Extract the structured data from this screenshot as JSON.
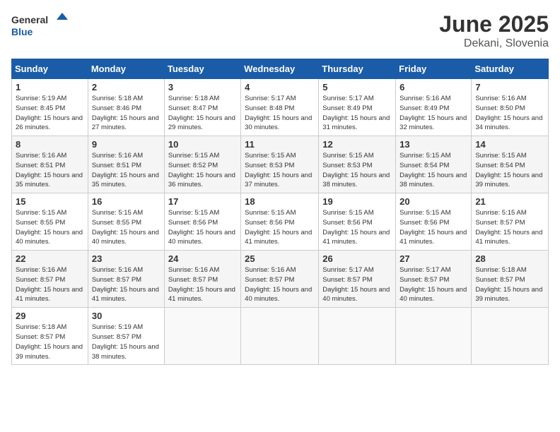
{
  "header": {
    "logo_line1": "General",
    "logo_line2": "Blue",
    "month_year": "June 2025",
    "location": "Dekani, Slovenia"
  },
  "columns": [
    "Sunday",
    "Monday",
    "Tuesday",
    "Wednesday",
    "Thursday",
    "Friday",
    "Saturday"
  ],
  "weeks": [
    [
      {
        "day": "1",
        "sunrise": "Sunrise: 5:19 AM",
        "sunset": "Sunset: 8:45 PM",
        "daylight": "Daylight: 15 hours and 26 minutes."
      },
      {
        "day": "2",
        "sunrise": "Sunrise: 5:18 AM",
        "sunset": "Sunset: 8:46 PM",
        "daylight": "Daylight: 15 hours and 27 minutes."
      },
      {
        "day": "3",
        "sunrise": "Sunrise: 5:18 AM",
        "sunset": "Sunset: 8:47 PM",
        "daylight": "Daylight: 15 hours and 29 minutes."
      },
      {
        "day": "4",
        "sunrise": "Sunrise: 5:17 AM",
        "sunset": "Sunset: 8:48 PM",
        "daylight": "Daylight: 15 hours and 30 minutes."
      },
      {
        "day": "5",
        "sunrise": "Sunrise: 5:17 AM",
        "sunset": "Sunset: 8:49 PM",
        "daylight": "Daylight: 15 hours and 31 minutes."
      },
      {
        "day": "6",
        "sunrise": "Sunrise: 5:16 AM",
        "sunset": "Sunset: 8:49 PM",
        "daylight": "Daylight: 15 hours and 32 minutes."
      },
      {
        "day": "7",
        "sunrise": "Sunrise: 5:16 AM",
        "sunset": "Sunset: 8:50 PM",
        "daylight": "Daylight: 15 hours and 34 minutes."
      }
    ],
    [
      {
        "day": "8",
        "sunrise": "Sunrise: 5:16 AM",
        "sunset": "Sunset: 8:51 PM",
        "daylight": "Daylight: 15 hours and 35 minutes."
      },
      {
        "day": "9",
        "sunrise": "Sunrise: 5:16 AM",
        "sunset": "Sunset: 8:51 PM",
        "daylight": "Daylight: 15 hours and 35 minutes."
      },
      {
        "day": "10",
        "sunrise": "Sunrise: 5:15 AM",
        "sunset": "Sunset: 8:52 PM",
        "daylight": "Daylight: 15 hours and 36 minutes."
      },
      {
        "day": "11",
        "sunrise": "Sunrise: 5:15 AM",
        "sunset": "Sunset: 8:53 PM",
        "daylight": "Daylight: 15 hours and 37 minutes."
      },
      {
        "day": "12",
        "sunrise": "Sunrise: 5:15 AM",
        "sunset": "Sunset: 8:53 PM",
        "daylight": "Daylight: 15 hours and 38 minutes."
      },
      {
        "day": "13",
        "sunrise": "Sunrise: 5:15 AM",
        "sunset": "Sunset: 8:54 PM",
        "daylight": "Daylight: 15 hours and 38 minutes."
      },
      {
        "day": "14",
        "sunrise": "Sunrise: 5:15 AM",
        "sunset": "Sunset: 8:54 PM",
        "daylight": "Daylight: 15 hours and 39 minutes."
      }
    ],
    [
      {
        "day": "15",
        "sunrise": "Sunrise: 5:15 AM",
        "sunset": "Sunset: 8:55 PM",
        "daylight": "Daylight: 15 hours and 40 minutes."
      },
      {
        "day": "16",
        "sunrise": "Sunrise: 5:15 AM",
        "sunset": "Sunset: 8:55 PM",
        "daylight": "Daylight: 15 hours and 40 minutes."
      },
      {
        "day": "17",
        "sunrise": "Sunrise: 5:15 AM",
        "sunset": "Sunset: 8:56 PM",
        "daylight": "Daylight: 15 hours and 40 minutes."
      },
      {
        "day": "18",
        "sunrise": "Sunrise: 5:15 AM",
        "sunset": "Sunset: 8:56 PM",
        "daylight": "Daylight: 15 hours and 41 minutes."
      },
      {
        "day": "19",
        "sunrise": "Sunrise: 5:15 AM",
        "sunset": "Sunset: 8:56 PM",
        "daylight": "Daylight: 15 hours and 41 minutes."
      },
      {
        "day": "20",
        "sunrise": "Sunrise: 5:15 AM",
        "sunset": "Sunset: 8:56 PM",
        "daylight": "Daylight: 15 hours and 41 minutes."
      },
      {
        "day": "21",
        "sunrise": "Sunrise: 5:15 AM",
        "sunset": "Sunset: 8:57 PM",
        "daylight": "Daylight: 15 hours and 41 minutes."
      }
    ],
    [
      {
        "day": "22",
        "sunrise": "Sunrise: 5:16 AM",
        "sunset": "Sunset: 8:57 PM",
        "daylight": "Daylight: 15 hours and 41 minutes."
      },
      {
        "day": "23",
        "sunrise": "Sunrise: 5:16 AM",
        "sunset": "Sunset: 8:57 PM",
        "daylight": "Daylight: 15 hours and 41 minutes."
      },
      {
        "day": "24",
        "sunrise": "Sunrise: 5:16 AM",
        "sunset": "Sunset: 8:57 PM",
        "daylight": "Daylight: 15 hours and 41 minutes."
      },
      {
        "day": "25",
        "sunrise": "Sunrise: 5:16 AM",
        "sunset": "Sunset: 8:57 PM",
        "daylight": "Daylight: 15 hours and 40 minutes."
      },
      {
        "day": "26",
        "sunrise": "Sunrise: 5:17 AM",
        "sunset": "Sunset: 8:57 PM",
        "daylight": "Daylight: 15 hours and 40 minutes."
      },
      {
        "day": "27",
        "sunrise": "Sunrise: 5:17 AM",
        "sunset": "Sunset: 8:57 PM",
        "daylight": "Daylight: 15 hours and 40 minutes."
      },
      {
        "day": "28",
        "sunrise": "Sunrise: 5:18 AM",
        "sunset": "Sunset: 8:57 PM",
        "daylight": "Daylight: 15 hours and 39 minutes."
      }
    ],
    [
      {
        "day": "29",
        "sunrise": "Sunrise: 5:18 AM",
        "sunset": "Sunset: 8:57 PM",
        "daylight": "Daylight: 15 hours and 39 minutes."
      },
      {
        "day": "30",
        "sunrise": "Sunrise: 5:19 AM",
        "sunset": "Sunset: 8:57 PM",
        "daylight": "Daylight: 15 hours and 38 minutes."
      },
      null,
      null,
      null,
      null,
      null
    ]
  ]
}
